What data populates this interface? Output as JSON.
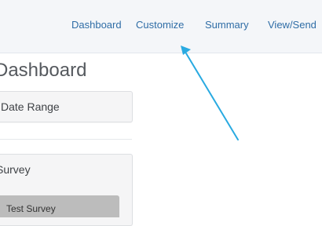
{
  "nav": {
    "items": [
      {
        "label": "Dashboard"
      },
      {
        "label": "Customize"
      },
      {
        "label": "Summary"
      },
      {
        "label": "View/Send"
      }
    ]
  },
  "main": {
    "title": "Dashboard",
    "date_range_label": "Date Range",
    "survey_panel_label": "Survey",
    "survey_item_label": "Test Survey"
  },
  "colors": {
    "topbar_background": "#f4f6f9",
    "link": "#2f6da6",
    "annotation_arrow": "#29aae1"
  }
}
